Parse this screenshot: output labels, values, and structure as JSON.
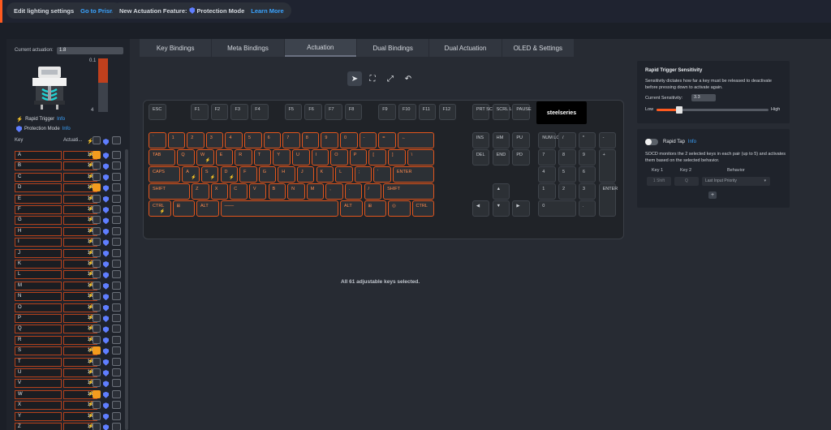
{
  "topbar": {
    "lighting": "Edit lighting settings",
    "prism": "Go to Prism",
    "feature_prefix": "New Actuation Feature:",
    "feature": "Protection Mode",
    "learn": "Learn More"
  },
  "left": {
    "current_actuation_label": "Current actuation:",
    "current_actuation_value": "1.8",
    "meter_top": "0.1",
    "meter_bottom": "4",
    "meter_fill_fraction": 0.45,
    "rapid_trigger": "Rapid Trigger",
    "protection": "Protection Mode",
    "info": "Info",
    "col_key": "Key",
    "col_actuation": "Actuati..."
  },
  "keys": [
    {
      "k": "A",
      "v": "1.8",
      "c": true
    },
    {
      "k": "B",
      "v": "1.8",
      "c": false
    },
    {
      "k": "C",
      "v": "1.8",
      "c": false
    },
    {
      "k": "D",
      "v": "1.8",
      "c": true
    },
    {
      "k": "E",
      "v": "1.8",
      "c": false
    },
    {
      "k": "F",
      "v": "1.8",
      "c": false
    },
    {
      "k": "G",
      "v": "1.8",
      "c": false
    },
    {
      "k": "H",
      "v": "1.8",
      "c": false
    },
    {
      "k": "I",
      "v": "1.8",
      "c": false
    },
    {
      "k": "J",
      "v": "1.8",
      "c": false
    },
    {
      "k": "K",
      "v": "1.8",
      "c": false
    },
    {
      "k": "L",
      "v": "1.8",
      "c": false
    },
    {
      "k": "M",
      "v": "1.8",
      "c": false
    },
    {
      "k": "N",
      "v": "1.8",
      "c": false
    },
    {
      "k": "O",
      "v": "1.8",
      "c": false
    },
    {
      "k": "P",
      "v": "1.8",
      "c": false
    },
    {
      "k": "Q",
      "v": "1.8",
      "c": false
    },
    {
      "k": "R",
      "v": "1.8",
      "c": false
    },
    {
      "k": "S",
      "v": "1.8",
      "c": true
    },
    {
      "k": "T",
      "v": "1.8",
      "c": false
    },
    {
      "k": "U",
      "v": "1.8",
      "c": false
    },
    {
      "k": "V",
      "v": "1.8",
      "c": false
    },
    {
      "k": "W",
      "v": "1.8",
      "c": true
    },
    {
      "k": "X",
      "v": "1.8",
      "c": false
    },
    {
      "k": "Y",
      "v": "1.8",
      "c": false
    },
    {
      "k": "Z",
      "v": "1.8",
      "c": false
    }
  ],
  "tabs": [
    "Key Bindings",
    "Meta Bindings",
    "Actuation",
    "Dual Bindings",
    "Dual Actuation",
    "OLED & Settings"
  ],
  "active_tab": 2,
  "oled": "steelseries",
  "status": "All 61 adjustable keys selected.",
  "sensitivity": {
    "title": "Rapid Trigger Sensitivity",
    "desc": "Sensitivity dictates how far a key must be released to deactivate before pressing down to activate again.",
    "current_label": "Current Sensitivity:",
    "current_value": "3.3",
    "low": "Low",
    "high": "High",
    "value_fraction": 0.2
  },
  "rapid_tap": {
    "title": "Rapid Tap",
    "info": "Info",
    "desc": "SOCD monitors the 2 selected keys in each pair (up to 5) and activates them based on the selected behavior.",
    "key1": "Key 1",
    "key2": "Key 2",
    "behavior": "Behavior",
    "key1_val": "1 Shift",
    "key2_val": "Q",
    "behavior_val": "Last Input Priority",
    "add": "+"
  },
  "colors": {
    "accent": "#ff5a1f",
    "link": "#3aa3ff",
    "selected_border": "#e3561d",
    "checkbox_on": "#f39c1e"
  }
}
